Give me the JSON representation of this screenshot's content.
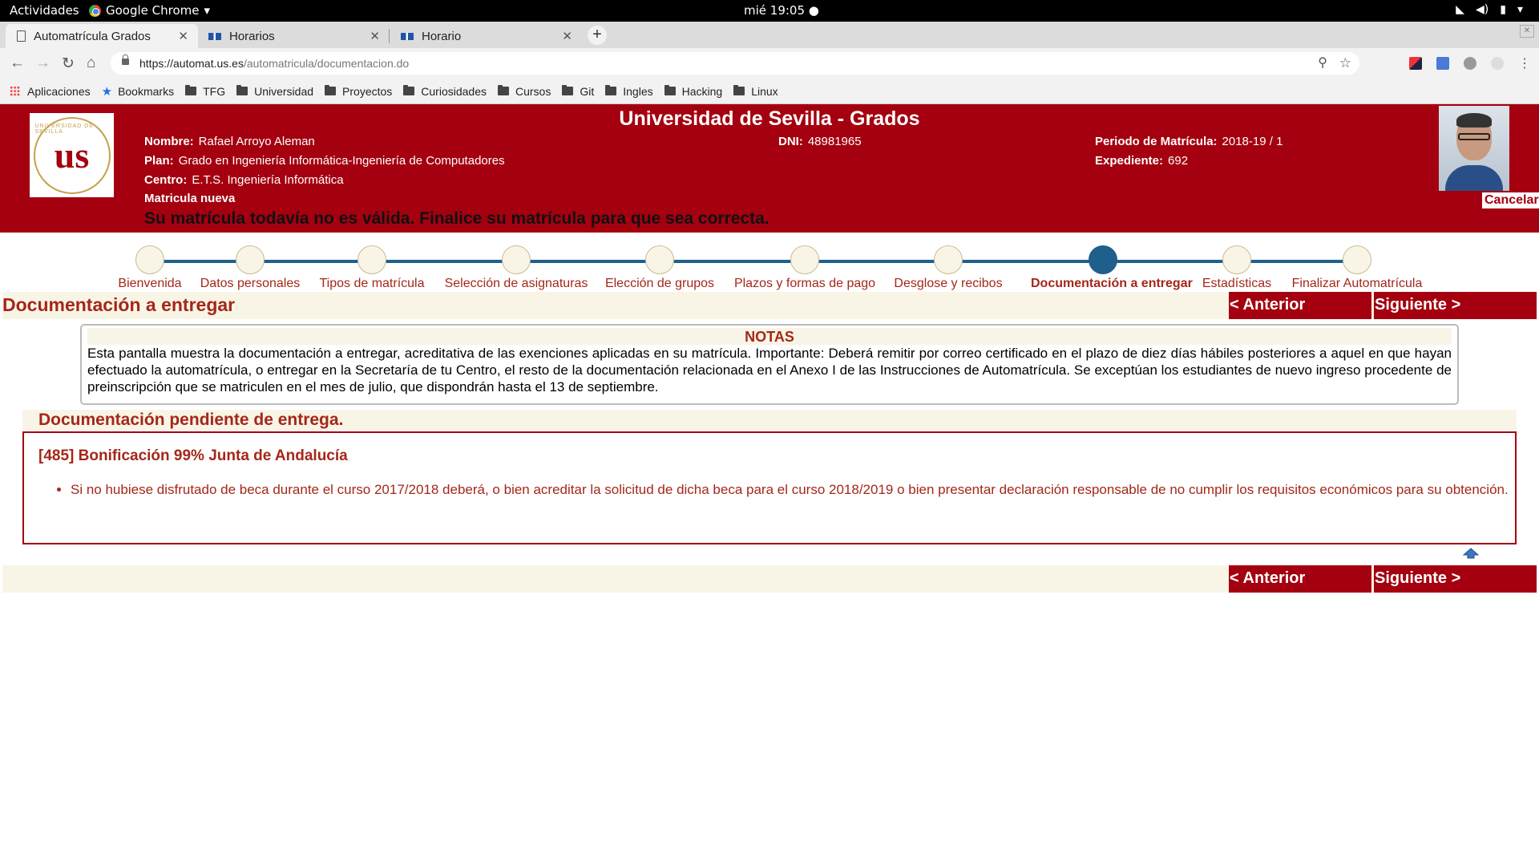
{
  "os": {
    "activities": "Actividades",
    "app_name": "Google Chrome",
    "clock": "mié 19:05"
  },
  "tabs": [
    {
      "title": "Automatrícula Grados"
    },
    {
      "title": "Horarios"
    },
    {
      "title": "Horario"
    }
  ],
  "address": {
    "host": "https://automat.us.es",
    "path": "/automatricula/documentacion.do"
  },
  "bookmarks": [
    "Aplicaciones",
    "Bookmarks",
    "TFG",
    "Universidad",
    "Proyectos",
    "Curiosidades",
    "Cursos",
    "Git",
    "Ingles",
    "Hacking",
    "Linux"
  ],
  "header": {
    "title": "Universidad de Sevilla - Grados",
    "nombre_label": "Nombre:",
    "nombre": "Rafael Arroyo Aleman",
    "plan_label": "Plan:",
    "plan": "Grado en Ingeniería Informática-Ingeniería de Computadores",
    "centro_label": "Centro:",
    "centro": "E.T.S. Ingeniería Informática",
    "matricula": "Matricula nueva",
    "dni_label": "DNI:",
    "dni": "48981965",
    "periodo_label": "Periodo de Matrícula:",
    "periodo": "2018-19 / 1",
    "expediente_label": "Expediente:",
    "expediente": "692",
    "warning": "Su matrícula todavía no es válida. Finalice su matrícula para que sea correcta.",
    "cancel": "Cancelar"
  },
  "steps": [
    {
      "label": "Bienvenida"
    },
    {
      "label": "Datos personales"
    },
    {
      "label": "Tipos de matrícula"
    },
    {
      "label": "Selección de asignaturas"
    },
    {
      "label": "Elección de grupos"
    },
    {
      "label": "Plazos y formas de pago"
    },
    {
      "label": "Desglose y recibos"
    },
    {
      "label": "Documentación a entregar"
    },
    {
      "label": "Estadísticas"
    },
    {
      "label": "Finalizar Automatrícula"
    }
  ],
  "current_step": 7,
  "section_title": "Documentación a entregar",
  "nav": {
    "prev": "< Anterior",
    "next": "Siguiente >"
  },
  "notes": {
    "title": "NOTAS",
    "body": "Esta pantalla muestra la documentación a entregar, acreditativa de las exenciones aplicadas en su matrícula. Importante: Deberá remitir por correo certificado en el plazo de diez días hábiles posteriores a aquel en que hayan efectuado la automatrícula, o entregar en la Secretaría de tu Centro, el resto de la documentación relacionada en el Anexo I de las Instrucciones de Automatrícula. Se exceptúan los estudiantes de nuevo ingreso procedente de preinscripción que se matriculen en el mes de julio, que dispondrán hasta el 13 de septiembre."
  },
  "pending": {
    "title": "Documentación pendiente de entrega.",
    "item_title": "[485] Bonificación 99% Junta de Andalucía",
    "item_text": "Si no hubiese disfrutado de beca durante el curso 2017/2018 deberá, o bien acreditar la solicitud de dicha beca para el curso 2018/2019 o bien presentar declaración responsable de no cumplir los requisitos económicos para su obtención."
  },
  "colors": {
    "brand": "#a4000f",
    "step_line": "#1f5f8b",
    "cream": "#f8f5e6",
    "text_red": "#a4271a"
  }
}
